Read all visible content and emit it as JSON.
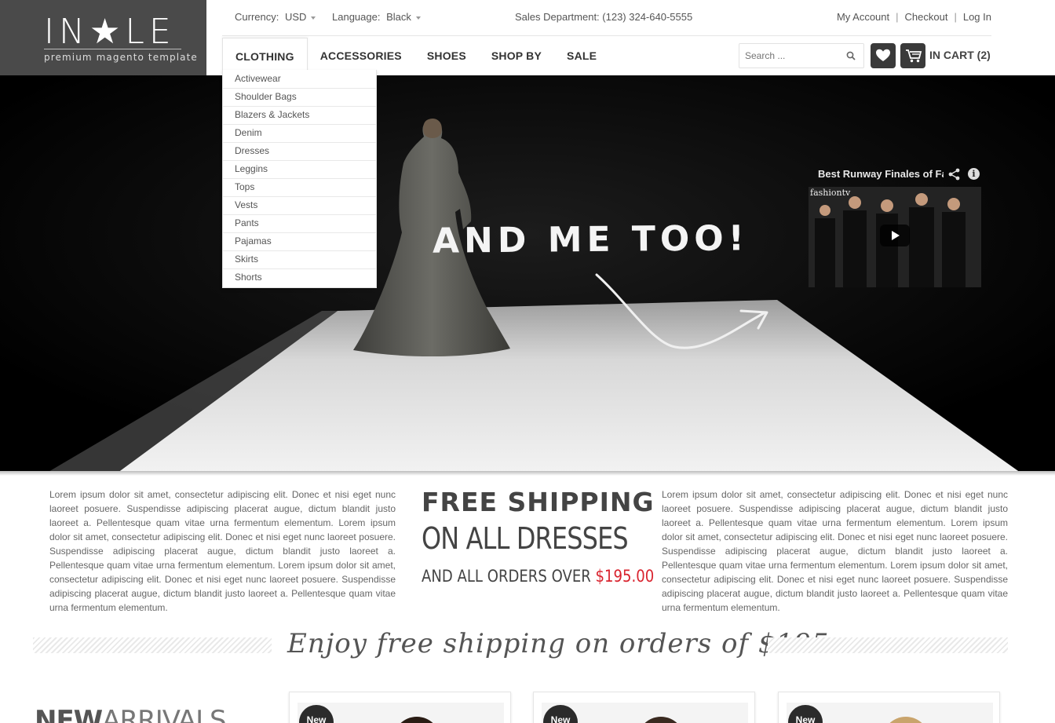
{
  "brand": {
    "logo_text": "IN★LE",
    "tagline": "premium magento template"
  },
  "topbar": {
    "currency_label": "Currency:",
    "currency_value": "USD",
    "language_label": "Language:",
    "language_value": "Black",
    "phone": "Sales Department: (123) 324-640-5555",
    "links": [
      "My Account",
      "Checkout",
      "Log In"
    ]
  },
  "nav": {
    "items": [
      "CLOTHING",
      "ACCESSORIES",
      "SHOES",
      "SHOP BY",
      "SALE"
    ],
    "active": "CLOTHING"
  },
  "search": {
    "placeholder": "Search ..."
  },
  "cart": {
    "label": "IN CART (2)"
  },
  "dropdown": {
    "items": [
      "Activewear",
      "Shoulder Bags",
      "Blazers & Jackets",
      "Denim",
      "Dresses",
      "Leggins",
      "Tops",
      "Vests",
      "Pants",
      "Pajamas",
      "Skirts",
      "Shorts"
    ]
  },
  "hero": {
    "handwritten": "AND ME TOO!",
    "video_title": "Best Runway Finales of Fa",
    "video_brand": "fashiontv",
    "info_glyph": "i"
  },
  "promo": {
    "lorem": "Lorem ipsum dolor sit amet, consectetur adipiscing elit. Donec et nisi eget nunc laoreet posuere. Suspendisse adipiscing placerat augue, dictum blandit justo laoreet a. Pellentesque quam vitae urna fermentum elementum. Lorem ipsum dolor sit amet, consectetur adipiscing elit. Donec et nisi eget nunc laoreet posuere. Suspendisse adipiscing placerat augue, dictum blandit justo laoreet a. Pellentesque quam vitae urna fermentum elementum. Lorem ipsum dolor sit amet, consectetur adipiscing elit. Donec et nisi eget nunc laoreet posuere. Suspendisse adipiscing placerat augue, dictum blandit justo laoreet a. Pellentesque quam vitae urna fermentum elementum.",
    "line1": "FREE SHIPPING",
    "line2": "ON ALL DRESSES",
    "line3_prefix": "AND ALL ORDERS OVER ",
    "line3_price": "$195.00",
    "price_color": "#d9232e",
    "script": "Enjoy free shipping on orders of $195"
  },
  "arrivals": {
    "heading_bold": "NEW",
    "heading_rest": "ARRIVALS",
    "badge": "New"
  }
}
